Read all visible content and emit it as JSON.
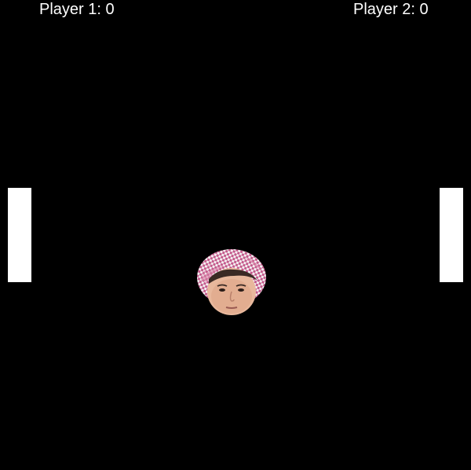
{
  "scoreboard": {
    "player1": {
      "label": "Player 1:",
      "score": "0",
      "text": "Player 1: 0"
    },
    "player2": {
      "label": "Player 2:",
      "score": "0",
      "text": "Player 2: 0"
    }
  },
  "colors": {
    "background": "#000000",
    "paddle": "#ffffff",
    "text": "#ffffff",
    "headscarf_pink": "#c45a8c",
    "headscarf_white": "#f4eef0",
    "skin": "#e8b89c"
  },
  "ball": {
    "icon": "face-with-keffiyeh-ball-icon"
  }
}
